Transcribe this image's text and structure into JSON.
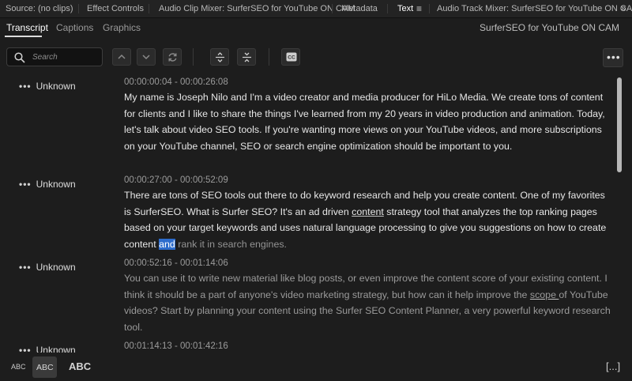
{
  "panel_tabs": [
    {
      "label": "Source: (no clips)",
      "active": false
    },
    {
      "label": "Effect Controls",
      "active": false
    },
    {
      "label": "Audio Clip Mixer: SurferSEO for YouTube ON CAM",
      "active": false
    },
    {
      "label": "Metadata",
      "active": false
    },
    {
      "label": "Text",
      "active": true
    },
    {
      "label": "Audio Track Mixer: SurferSEO for YouTube ON CAM",
      "active": false
    }
  ],
  "panel_icons": {
    "menu": "≡",
    "overflow": "»"
  },
  "subtabs": [
    {
      "label": "Transcript",
      "active": true
    },
    {
      "label": "Captions",
      "active": false
    },
    {
      "label": "Graphics",
      "active": false
    }
  ],
  "sequence_name": "SurferSEO for YouTube ON CAM",
  "search": {
    "placeholder": "Search",
    "value": ""
  },
  "toolbar_icons": [
    "chevron-up-icon",
    "chevron-down-icon",
    "refresh-icon",
    "merge-segments-icon",
    "split-segment-icon",
    "create-captions-icon"
  ],
  "more_label": "•••",
  "speaker_dots": "•••",
  "segments": [
    {
      "speaker": "Unknown",
      "timecode": "00:00:00:04 - 00:00:26:08",
      "text_a": "My name is Joseph Nilo and I'm a video creator and media producer for HiLo Media. We create tons of content for clients and I like to share the things I've learned from my 20 years in video production and animation. Today, let's talk about video SEO tools. If you're wanting more views on your YouTube videos, and more subscriptions on your YouTube channel, SEO or search engine optimization should be important to you."
    },
    {
      "speaker": "Unknown",
      "timecode": "00:00:27:00 - 00:00:52:09",
      "text_a": "There are tons of SEO tools out there to do keyword research and help you create content. One of my favorites is SurferSEO. What is Surfer SEO? It's an ad driven ",
      "text_u": "content",
      "text_b": " strategy tool that analyzes the top ranking pages based on your target keywords and uses natural language processing to give you suggestions on how to create content ",
      "text_hl": "and",
      "text_muted": " rank it in search engines."
    },
    {
      "speaker": "Unknown",
      "timecode": "00:00:52:16 - 00:01:14:06",
      "text_a": "You can use it to write new material like blog posts, or even improve the content score of your existing content. I think it should be a part of anyone's video marketing strategy, but how can it help improve the ",
      "text_u": "scope ",
      "text_b": "of YouTube videos? Start by planning your content using the Surfer SEO Content Planner, a very powerful keyword research tool."
    },
    {
      "speaker": "Unknown",
      "timecode": "00:01:14:13 - 00:01:42:16"
    }
  ],
  "case_options": {
    "small": "ABC",
    "medium": "ABC",
    "large": "ABC"
  },
  "fit_label": "[...]"
}
